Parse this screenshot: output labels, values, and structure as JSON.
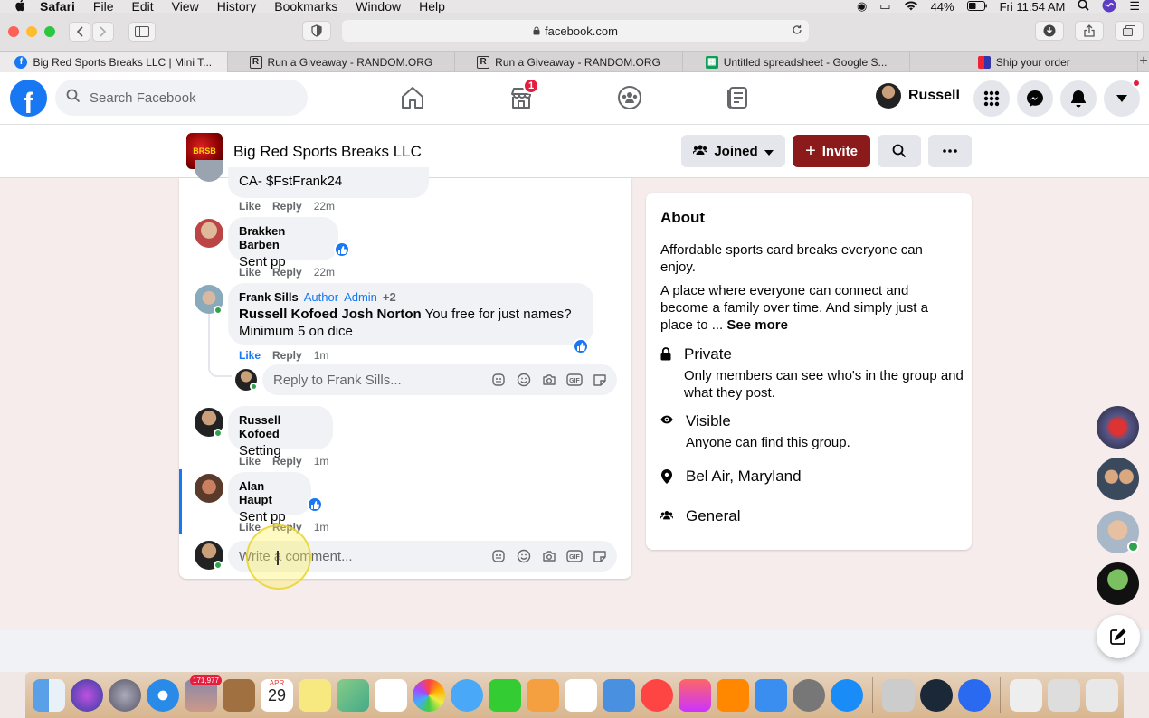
{
  "menubar": {
    "app_name": "Safari",
    "items": [
      "File",
      "Edit",
      "View",
      "History",
      "Bookmarks",
      "Window",
      "Help"
    ],
    "battery": "44%",
    "clock": "Fri 11:54 AM"
  },
  "browser": {
    "url": "facebook.com",
    "tabs": [
      {
        "label": "Big Red Sports Breaks LLC | Mini T...",
        "icon": "facebook-icon"
      },
      {
        "label": "Run a Giveaway - RANDOM.ORG",
        "icon": "random-org-icon"
      },
      {
        "label": "Run a Giveaway - RANDOM.ORG",
        "icon": "random-org-icon"
      },
      {
        "label": "Untitled spreadsheet - Google S...",
        "icon": "sheets-icon"
      },
      {
        "label": "Ship your order",
        "icon": "ship-icon"
      }
    ]
  },
  "fbnav": {
    "search_placeholder": "Search Facebook",
    "marketplace_badge": "1",
    "profile_name": "Russell"
  },
  "group": {
    "name": "Big Red Sports Breaks LLC",
    "joined_label": "Joined",
    "invite_label": "Invite"
  },
  "comments": {
    "partial": {
      "text": "CA- $FstFrank24",
      "like": "Like",
      "reply": "Reply",
      "time": "22m"
    },
    "items": [
      {
        "name": "Brakken Barben",
        "text": "Sent pp",
        "like": "Like",
        "reply": "Reply",
        "time": "22m"
      },
      {
        "name": "Frank Sills",
        "tags": [
          "Author",
          "Admin"
        ],
        "more": "+2",
        "mention": "Russell Kofoed Josh Norton",
        "text": " You free for just names? Minimum 5 on dice",
        "like": "Like",
        "reply": "Reply",
        "time": "1m"
      },
      {
        "name": "Russell Kofoed",
        "text": "Setting",
        "like": "Like",
        "reply": "Reply",
        "time": "1m"
      },
      {
        "name": "Alan Haupt",
        "text": "Sent pp",
        "like": "Like",
        "reply": "Reply",
        "time": "1m"
      }
    ],
    "reply_placeholder": "Reply to Frank Sills...",
    "comment_placeholder": "Write a comment..."
  },
  "about": {
    "title": "About",
    "desc1": "Affordable sports card breaks everyone can enjoy.",
    "desc2": "A place where everyone can connect and become a family over time. And simply just a place to ... ",
    "see_more": "See more",
    "private_title": "Private",
    "private_sub": "Only members can see who's in the group and what they post.",
    "visible_title": "Visible",
    "visible_sub": "Anyone can find this group.",
    "location": "Bel Air, Maryland",
    "category": "General"
  },
  "dock": {
    "mail_badge": "171,977",
    "calendar_month": "APR",
    "calendar_day": "29"
  },
  "colors": {
    "fb_blue": "#1877f2",
    "group_red": "#8b1a1a",
    "online_green": "#31a24c"
  }
}
